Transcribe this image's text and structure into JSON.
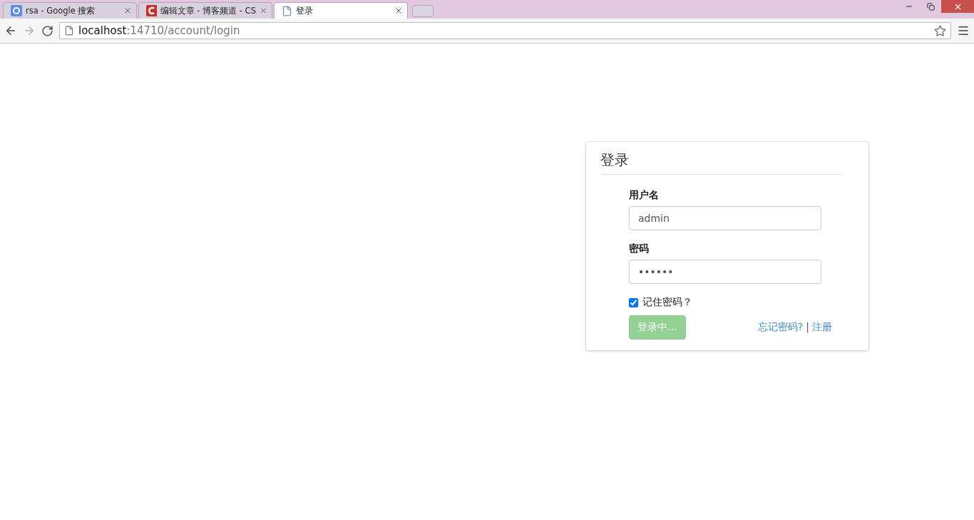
{
  "browser": {
    "tabs": [
      {
        "title": "rsa - Google 搜索",
        "kind": "google",
        "selected": false
      },
      {
        "title": "编辑文章 - 博客频道 - CS",
        "kind": "csdn",
        "selected": false
      },
      {
        "title": "登录",
        "kind": "page",
        "selected": true
      }
    ],
    "address": {
      "host": "localhost",
      "path": ":14710/account/login"
    }
  },
  "login": {
    "title": "登录",
    "username": {
      "label": "用户名",
      "value": "admin"
    },
    "password": {
      "label": "密码",
      "value": "••••••"
    },
    "remember": {
      "label": "记住密码？",
      "checked": true
    },
    "submit": {
      "label": "登录中...",
      "disabled": true
    },
    "links": [
      {
        "label": "忘记密码?"
      },
      {
        "label": "注册"
      }
    ],
    "separator": "|"
  }
}
